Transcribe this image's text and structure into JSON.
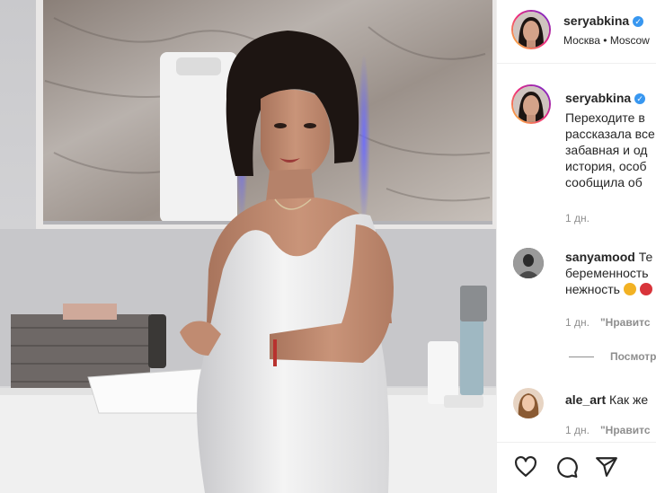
{
  "post": {
    "author": {
      "username": "seryabkina",
      "verified": true,
      "location": "Москва • Moscow"
    },
    "caption": {
      "username": "seryabkina",
      "lines": [
        "Переходите в",
        "рассказала все",
        "забавная и од",
        "история, особ",
        "сообщила об"
      ],
      "time": "1 дн."
    },
    "comments": [
      {
        "username": "sanyamood",
        "text_lines": [
          "Те",
          "беременность",
          "нежность"
        ],
        "time": "1 дн.",
        "like_label": "\"Нравитс",
        "replies_label": "Посмотр"
      },
      {
        "username": "ale_art",
        "text_lines": [
          "Как же"
        ],
        "time": "1 дн.",
        "like_label": "\"Нравитс"
      }
    ],
    "actions": [
      {
        "icon": "heart-icon"
      },
      {
        "icon": "comment-icon"
      },
      {
        "icon": "share-icon"
      }
    ]
  }
}
